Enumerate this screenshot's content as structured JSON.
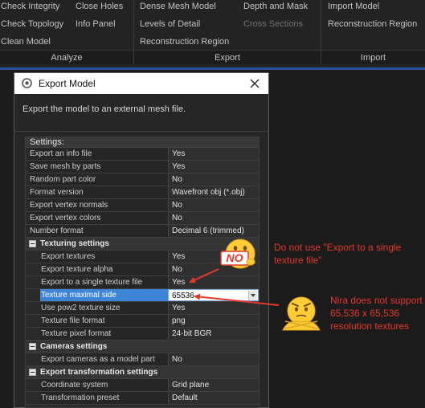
{
  "ribbon": {
    "groups": [
      {
        "name": "analyze",
        "label": "Analyze",
        "items": [
          "Check Integrity",
          "Close Holes",
          "Check Topology",
          "Info Panel",
          "Clean Model"
        ]
      },
      {
        "name": "export",
        "label": "Export",
        "items": [
          "Dense Mesh Model",
          "Depth and Mask",
          "Levels of Detail",
          "Cross Sections",
          "Reconstruction Region"
        ],
        "disabled": [
          "Cross Sections"
        ]
      },
      {
        "name": "import",
        "label": "Import",
        "items": [
          "Import Model",
          "Reconstruction Region"
        ]
      }
    ]
  },
  "dialog": {
    "title": "Export Model",
    "description": "Export the model to an external mesh file.",
    "settings_header": "Settings:",
    "rows": [
      {
        "name": "Export an info file",
        "value": "Yes"
      },
      {
        "name": "Save mesh by parts",
        "value": "Yes"
      },
      {
        "name": "Random part color",
        "value": "No"
      },
      {
        "name": "Format version",
        "value": "Wavefront obj (*.obj)"
      },
      {
        "name": "Export vertex normals",
        "value": "No"
      },
      {
        "name": "Export vertex colors",
        "value": "No"
      },
      {
        "name": "Number format",
        "value": "Decimal 6 (trimmed)"
      }
    ],
    "sections": [
      {
        "label": "Texturing settings",
        "rows": [
          {
            "name": "Export textures",
            "value": "Yes"
          },
          {
            "name": "Export texture alpha",
            "value": "No"
          },
          {
            "name": "Export to a single texture file",
            "value": "Yes"
          },
          {
            "name": "Texture maximal side",
            "value": "65536"
          },
          {
            "name": "Use pow2 texture size",
            "value": "Yes"
          },
          {
            "name": "Texture file format",
            "value": "png"
          },
          {
            "name": "Texture pixel format",
            "value": "24-bit BGR"
          }
        ]
      },
      {
        "label": "Cameras settings",
        "rows": [
          {
            "name": "Export cameras as a model part",
            "value": "No"
          }
        ]
      },
      {
        "label": "Export transformation settings",
        "rows": [
          {
            "name": "Coordinate system",
            "value": "Grid plane"
          },
          {
            "name": "Transformation preset",
            "value": "Default"
          }
        ]
      }
    ]
  },
  "annotations": {
    "note1": "Do not use \"Export to a single texture file\"",
    "note2": "Nira does not support 65,536 x 65,536 resolution textures",
    "no_badge": "NO",
    "color": "#e3382d"
  },
  "colors": {
    "accent_bar": "#27509d",
    "selection": "#3d83d6",
    "emoji_yellow": "#ffcc33"
  }
}
